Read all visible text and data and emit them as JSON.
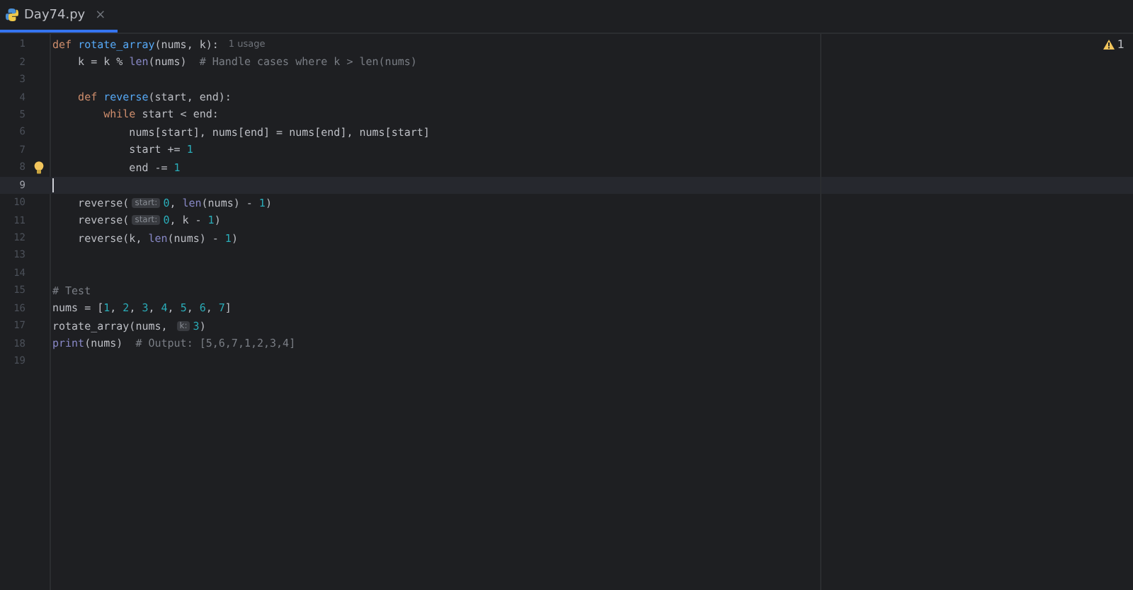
{
  "tabs": [
    {
      "label": "Day74.py",
      "close": "×",
      "selected": true
    }
  ],
  "inspection": {
    "count": "1"
  },
  "lines": [
    {
      "no": "1",
      "current": false,
      "tokens": [
        {
          "kind": "kw",
          "t": "def "
        },
        {
          "kind": "fn",
          "t": "rotate_array"
        },
        {
          "kind": "p",
          "t": "(nums, k):"
        },
        {
          "kind": "usage",
          "t": "1 usage"
        }
      ]
    },
    {
      "no": "2",
      "current": false,
      "tokens": [
        {
          "kind": "p",
          "t": "    k = k % "
        },
        {
          "kind": "bi",
          "t": "len"
        },
        {
          "kind": "p",
          "t": "(nums)  "
        },
        {
          "kind": "cm",
          "t": "# Handle cases where k > len(nums)"
        }
      ]
    },
    {
      "no": "3",
      "current": false
    },
    {
      "no": "4",
      "current": false,
      "tokens": [
        {
          "kind": "kw",
          "t": "    def "
        },
        {
          "kind": "fn",
          "t": "reverse"
        },
        {
          "kind": "p",
          "t": "(start, end):"
        }
      ]
    },
    {
      "no": "5",
      "current": false,
      "tokens": [
        {
          "kind": "kw",
          "t": "        while "
        },
        {
          "kind": "p",
          "t": "start < end:"
        }
      ]
    },
    {
      "no": "6",
      "current": false,
      "tokens": [
        {
          "kind": "p",
          "t": "            nums[start], nums[end] = nums[end], nums[start]"
        }
      ]
    },
    {
      "no": "7",
      "current": false,
      "tokens": [
        {
          "kind": "p",
          "t": "            start += "
        },
        {
          "kind": "num",
          "t": "1"
        }
      ]
    },
    {
      "no": "8",
      "current": false,
      "bulb": true,
      "tokens": [
        {
          "kind": "p",
          "t": "            end -= "
        },
        {
          "kind": "num",
          "t": "1"
        }
      ]
    },
    {
      "no": "9",
      "current": true
    },
    {
      "no": "10",
      "current": false,
      "tokens": [
        {
          "kind": "p",
          "t": "    reverse("
        },
        {
          "kind": "hint",
          "t": "start:"
        },
        {
          "kind": "num",
          "t": "0"
        },
        {
          "kind": "p",
          "t": ", "
        },
        {
          "kind": "bi",
          "t": "len"
        },
        {
          "kind": "p",
          "t": "(nums) - "
        },
        {
          "kind": "num",
          "t": "1"
        },
        {
          "kind": "p",
          "t": ")"
        }
      ]
    },
    {
      "no": "11",
      "current": false,
      "tokens": [
        {
          "kind": "p",
          "t": "    reverse("
        },
        {
          "kind": "hint",
          "t": "start:"
        },
        {
          "kind": "num",
          "t": "0"
        },
        {
          "kind": "p",
          "t": ", k - "
        },
        {
          "kind": "num",
          "t": "1"
        },
        {
          "kind": "p",
          "t": ")"
        }
      ]
    },
    {
      "no": "12",
      "current": false,
      "tokens": [
        {
          "kind": "p",
          "t": "    reverse(k, "
        },
        {
          "kind": "bi",
          "t": "len"
        },
        {
          "kind": "p",
          "t": "(nums) - "
        },
        {
          "kind": "num",
          "t": "1"
        },
        {
          "kind": "p",
          "t": ")"
        }
      ]
    },
    {
      "no": "13",
      "current": false
    },
    {
      "no": "14",
      "current": false
    },
    {
      "no": "15",
      "current": false,
      "tokens": [
        {
          "kind": "cm",
          "t": "# Test"
        }
      ]
    },
    {
      "no": "16",
      "current": false,
      "tokens": [
        {
          "kind": "p",
          "t": "nums = ["
        },
        {
          "kind": "num",
          "t": "1"
        },
        {
          "kind": "p",
          "t": ", "
        },
        {
          "kind": "num",
          "t": "2"
        },
        {
          "kind": "p",
          "t": ", "
        },
        {
          "kind": "num",
          "t": "3"
        },
        {
          "kind": "p",
          "t": ", "
        },
        {
          "kind": "num",
          "t": "4"
        },
        {
          "kind": "p",
          "t": ", "
        },
        {
          "kind": "num",
          "t": "5"
        },
        {
          "kind": "p",
          "t": ", "
        },
        {
          "kind": "num",
          "t": "6"
        },
        {
          "kind": "p",
          "t": ", "
        },
        {
          "kind": "num",
          "t": "7"
        },
        {
          "kind": "p",
          "t": "]"
        }
      ]
    },
    {
      "no": "17",
      "current": false,
      "tokens": [
        {
          "kind": "p",
          "t": "rotate_array(nums, "
        },
        {
          "kind": "hint",
          "t": "k:"
        },
        {
          "kind": "num",
          "t": "3"
        },
        {
          "kind": "p",
          "t": ")"
        }
      ]
    },
    {
      "no": "18",
      "current": false,
      "tokens": [
        {
          "kind": "bi",
          "t": "print"
        },
        {
          "kind": "p",
          "t": "(nums)  "
        },
        {
          "kind": "cm",
          "t": "# Output: [5,6,7,1,2,3,4]"
        }
      ]
    },
    {
      "no": "19",
      "current": false
    }
  ]
}
